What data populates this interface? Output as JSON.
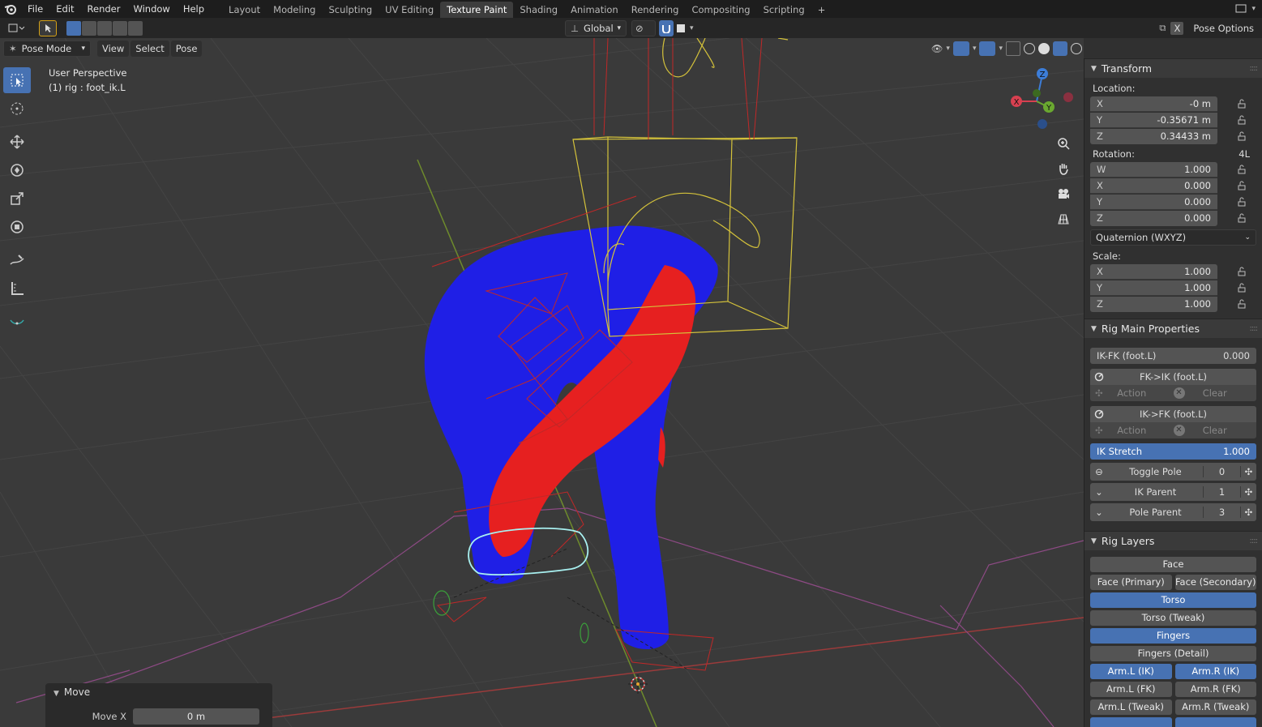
{
  "menu": [
    "File",
    "Edit",
    "Render",
    "Window",
    "Help"
  ],
  "workspaces": [
    "Layout",
    "Modeling",
    "Sculpting",
    "UV Editing",
    "Texture Paint",
    "Shading",
    "Animation",
    "Rendering",
    "Compositing",
    "Scripting"
  ],
  "active_workspace": "Texture Paint",
  "header": {
    "orientation": "Global",
    "pose_options": "Pose Options",
    "close_x": "X"
  },
  "viewport": {
    "mode": "Pose Mode",
    "menus": [
      "View",
      "Select",
      "Pose"
    ],
    "info_line1": "User Perspective",
    "info_line2": "(1) rig : foot_ik.L",
    "gizmo": {
      "x": "X",
      "y": "Y",
      "z": "Z"
    },
    "move_panel": {
      "title": "Move",
      "label": "Move X",
      "value": "0 m"
    }
  },
  "transform": {
    "title": "Transform",
    "location_label": "Location:",
    "location": [
      {
        "axis": "X",
        "value": "-0 m"
      },
      {
        "axis": "Y",
        "value": "-0.35671 m"
      },
      {
        "axis": "Z",
        "value": "0.34433 m"
      }
    ],
    "rotation_label": "Rotation:",
    "rotation_lock_label": "4L",
    "rotation": [
      {
        "axis": "W",
        "value": "1.000"
      },
      {
        "axis": "X",
        "value": "0.000"
      },
      {
        "axis": "Y",
        "value": "0.000"
      },
      {
        "axis": "Z",
        "value": "0.000"
      }
    ],
    "rotation_mode": "Quaternion (WXYZ)",
    "scale_label": "Scale:",
    "scale": [
      {
        "axis": "X",
        "value": "1.000"
      },
      {
        "axis": "Y",
        "value": "1.000"
      },
      {
        "axis": "Z",
        "value": "1.000"
      }
    ]
  },
  "rig_main": {
    "title": "Rig Main Properties",
    "ikfk_label": "IK-FK (foot.L)",
    "ikfk_value": "0.000",
    "fk_to_ik": "FK->IK (foot.L)",
    "ik_to_fk": "IK->FK (foot.L)",
    "action_label": "Action",
    "clear_label": "Clear",
    "ik_stretch_label": "IK Stretch",
    "ik_stretch_value": "1.000",
    "toggle_pole_label": "Toggle Pole",
    "toggle_pole_value": "0",
    "ik_parent_label": "IK Parent",
    "ik_parent_value": "1",
    "pole_parent_label": "Pole Parent",
    "pole_parent_value": "3"
  },
  "rig_layers": {
    "title": "Rig Layers",
    "face": "Face",
    "face_primary": "Face (Primary)",
    "face_secondary": "Face (Secondary)",
    "torso": "Torso",
    "torso_tweak": "Torso (Tweak)",
    "fingers": "Fingers",
    "fingers_detail": "Fingers (Detail)",
    "arm_l_ik": "Arm.L (IK)",
    "arm_r_ik": "Arm.R (IK)",
    "arm_l_fk": "Arm.L (FK)",
    "arm_r_fk": "Arm.R (FK)",
    "arm_l_tweak": "Arm.L (Tweak)",
    "arm_r_tweak": "Arm.R (Tweak)"
  },
  "colors": {
    "accent": "#4772b3",
    "mesh_blue": "#1f1fe6",
    "mesh_red": "#e62020",
    "bone_yellow": "#d4c23a",
    "bone_red": "#c02828",
    "selected_bone": "#a8f0f0"
  }
}
